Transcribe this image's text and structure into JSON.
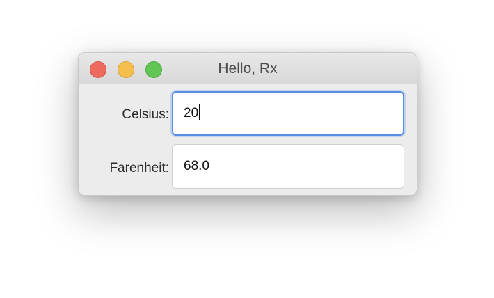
{
  "window": {
    "title": "Hello, Rx"
  },
  "form": {
    "celsius_label": "Celsius:",
    "celsius_value": "20",
    "farenheit_label": "Farenheit:",
    "farenheit_value": "68.0"
  },
  "colors": {
    "close": "#ed6a5e",
    "minimize": "#f5bf4f",
    "maximize": "#61c554",
    "focus_ring": "#5a8ee0"
  }
}
